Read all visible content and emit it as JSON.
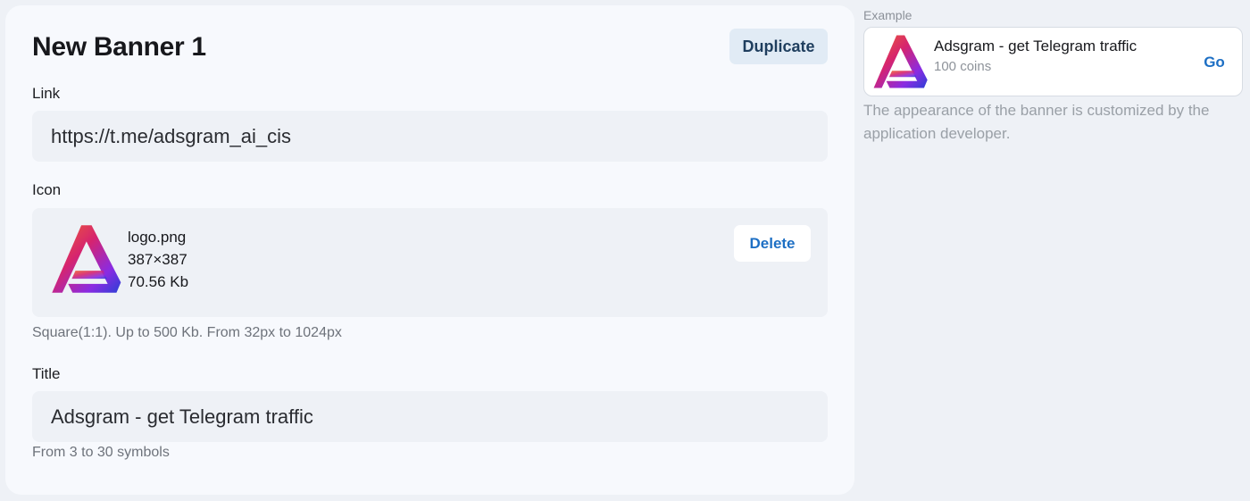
{
  "banner": {
    "title": "New Banner 1",
    "duplicate_label": "Duplicate",
    "link": {
      "label": "Link",
      "value": "https://t.me/adsgram_ai_cis"
    },
    "icon": {
      "label": "Icon",
      "file_name": "logo.png",
      "dimensions": "387×387",
      "file_size": "70.56 Kb",
      "delete_label": "Delete",
      "hint": "Square(1:1). Up to 500 Kb. From 32px to 1024px",
      "logo_icon": "adsgram-logo-icon"
    },
    "title_field": {
      "label": "Title",
      "value": "Adsgram - get Telegram traffic",
      "hint": "From 3 to 30 symbols"
    }
  },
  "example": {
    "label": "Example",
    "title": "Adsgram - get Telegram traffic",
    "subtitle": "100 coins",
    "go_label": "Go",
    "note": "The appearance of the banner is customized by the application developer."
  },
  "colors": {
    "accent": "#1d6fc4",
    "logo_gradient": [
      "#f0652f",
      "#d6246e",
      "#8a2be2",
      "#2b3fd6"
    ]
  }
}
